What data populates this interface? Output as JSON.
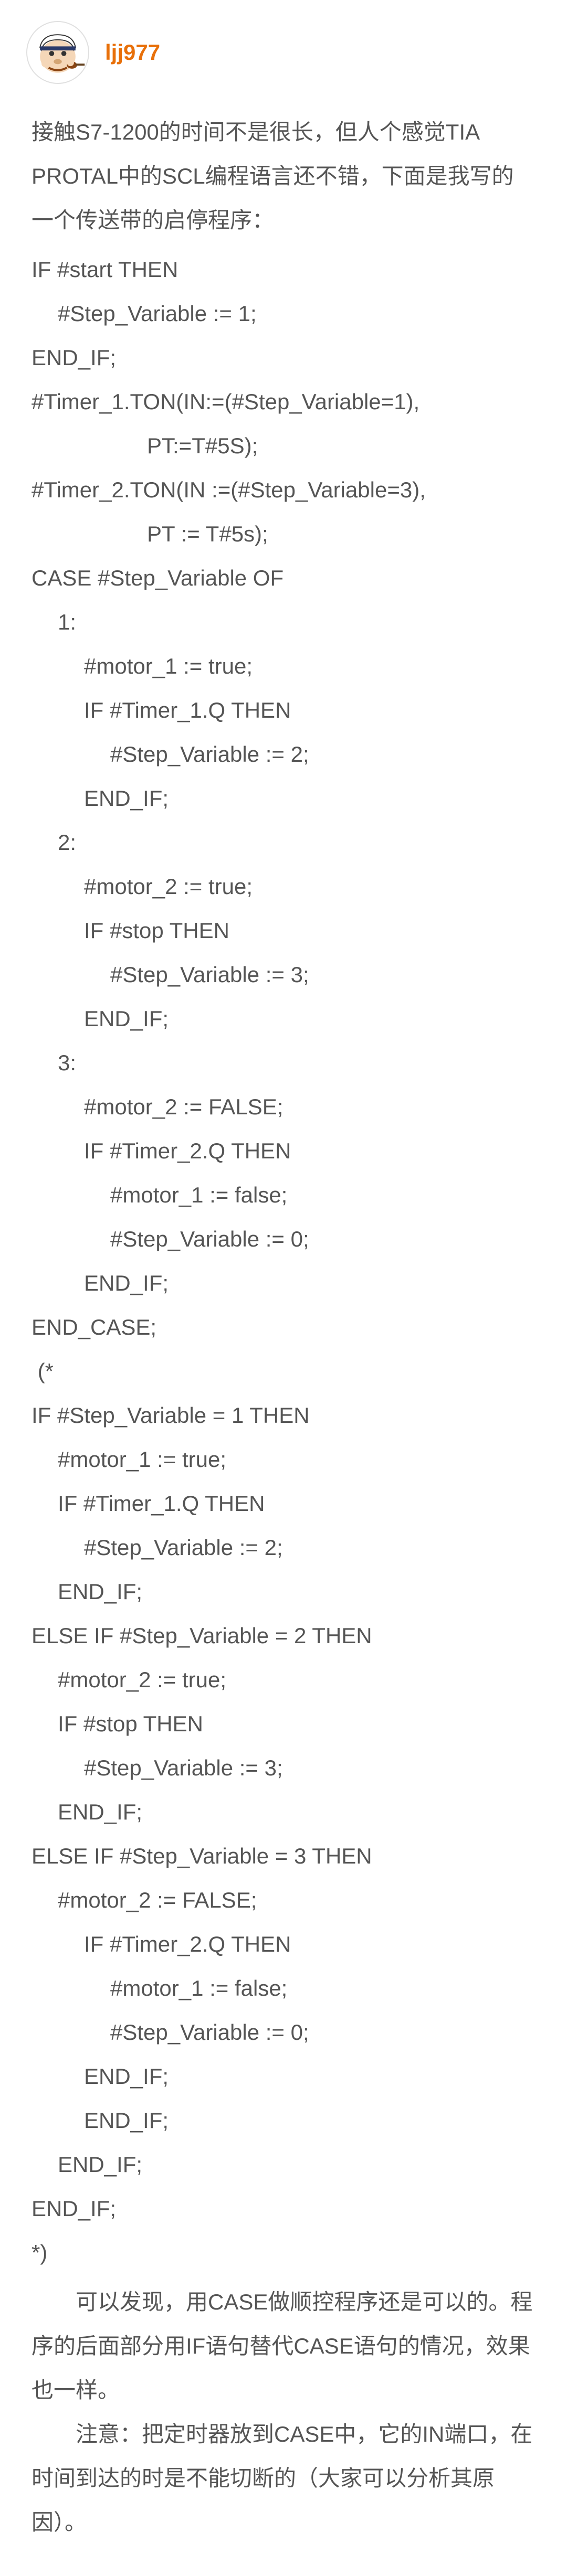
{
  "author": {
    "username": "ljj977"
  },
  "intro": "接触S7-1200的时间不是很长，但人个感觉TIA PROTAL中的SCL编程语言还不错，下面是我写的一个传送带的启停程序：",
  "code_lines": [
    {
      "text": "IF #start THEN",
      "indent": 0
    },
    {
      "text": "#Step_Variable := 1;",
      "indent": 1
    },
    {
      "text": "END_IF;",
      "indent": 0
    },
    {
      "text": "#Timer_1.TON(IN:=(#Step_Variable=1),",
      "indent": 0
    },
    {
      "text": "PT:=T#5S);",
      "indent": 15
    },
    {
      "text": "#Timer_2.TON(IN :=(#Step_Variable=3),",
      "indent": 0
    },
    {
      "text": "PT := T#5s);",
      "indent": 15
    },
    {
      "text": "CASE #Step_Variable OF",
      "indent": 0
    },
    {
      "text": "1:",
      "indent": 1
    },
    {
      "text": "#motor_1 := true;",
      "indent": 2
    },
    {
      "text": "IF #Timer_1.Q THEN",
      "indent": 2
    },
    {
      "text": "#Step_Variable := 2;",
      "indent": 3
    },
    {
      "text": "END_IF;",
      "indent": 2
    },
    {
      "text": "2:",
      "indent": 1
    },
    {
      "text": "#motor_2 := true;",
      "indent": 2
    },
    {
      "text": "IF #stop THEN",
      "indent": 2
    },
    {
      "text": "#Step_Variable := 3;",
      "indent": 3
    },
    {
      "text": "END_IF;",
      "indent": 2
    },
    {
      "text": "3:",
      "indent": 1
    },
    {
      "text": "#motor_2 := FALSE;",
      "indent": 2
    },
    {
      "text": "IF #Timer_2.Q THEN",
      "indent": 2
    },
    {
      "text": "#motor_1 := false;",
      "indent": 3
    },
    {
      "text": "#Step_Variable := 0;",
      "indent": 3
    },
    {
      "text": "END_IF;",
      "indent": 2
    },
    {
      "text": "END_CASE;",
      "indent": 0
    },
    {
      "text": " (*",
      "indent": 0
    },
    {
      "text": "IF #Step_Variable = 1 THEN",
      "indent": 0
    },
    {
      "text": "#motor_1 := true;",
      "indent": 1
    },
    {
      "text": "IF #Timer_1.Q THEN",
      "indent": 1
    },
    {
      "text": "#Step_Variable := 2;",
      "indent": 2
    },
    {
      "text": "END_IF;",
      "indent": 1
    },
    {
      "text": "ELSE IF #Step_Variable = 2 THEN",
      "indent": 0
    },
    {
      "text": "#motor_2 := true;",
      "indent": 1
    },
    {
      "text": "IF #stop THEN",
      "indent": 1
    },
    {
      "text": "#Step_Variable := 3;",
      "indent": 2
    },
    {
      "text": "END_IF;",
      "indent": 1
    },
    {
      "text": "ELSE IF #Step_Variable = 3 THEN",
      "indent": 0
    },
    {
      "text": "#motor_2 := FALSE;",
      "indent": 1
    },
    {
      "text": "IF #Timer_2.Q THEN",
      "indent": 2
    },
    {
      "text": "#motor_1 := false;",
      "indent": 3
    },
    {
      "text": "#Step_Variable := 0;",
      "indent": 3
    },
    {
      "text": "END_IF;",
      "indent": 2
    },
    {
      "text": "END_IF;",
      "indent": 2
    },
    {
      "text": "END_IF;",
      "indent": 1
    },
    {
      "text": "END_IF;",
      "indent": 0
    },
    {
      "text": "*)",
      "indent": 0
    }
  ],
  "conclusion_1": "可以发现，用CASE做顺控程序还是可以的。程序的后面部分用IF语句替代CASE语句的情况，效果也一样。",
  "conclusion_2": "注意：把定时器放到CASE中，它的IN端口，在时间到达的时是不能切断的（大家可以分析其原因）。"
}
